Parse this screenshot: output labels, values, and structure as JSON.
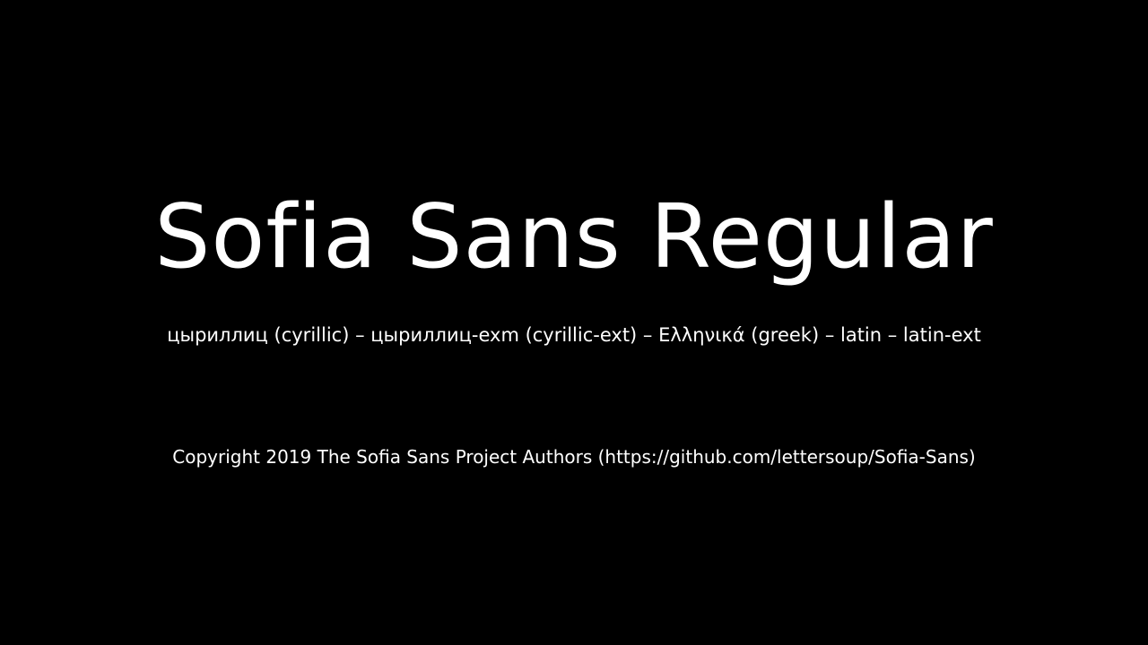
{
  "specimen": {
    "title": "Sofia Sans Regular",
    "subsets": "цыриллиц (cyrillic) – цыриллиц-exm (cyrillic-ext) – Ελληνικά (greek) – latin – latin-ext",
    "copyright": "Copyright 2019 The Sofia Sans Project Authors (https://github.com/lettersoup/Sofia-Sans)"
  },
  "colors": {
    "background": "#000000",
    "text": "#ffffff"
  }
}
